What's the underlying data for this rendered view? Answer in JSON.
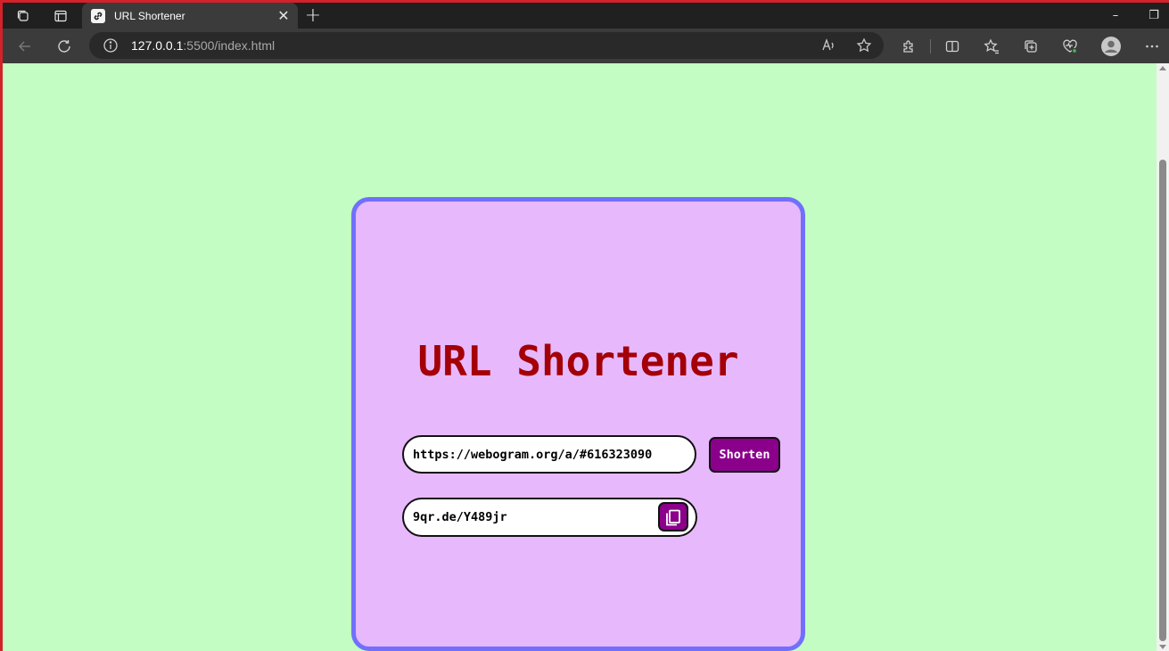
{
  "browser": {
    "tab_title": "URL Shortener",
    "address": {
      "host": "127.0.0.1",
      "rest": ":5500/index.html"
    },
    "window_controls": {
      "minimize": "–",
      "restore": "❐"
    }
  },
  "page": {
    "title": "URL Shortener",
    "url_input_value": "https://webogram.org/a/#616323090",
    "shorten_label": "Shorten",
    "short_url": "9qr.de/Y489jr"
  },
  "colors": {
    "page_background": "#c3fdc3",
    "card_background": "#e7b8fc",
    "card_border": "#7070fb",
    "title": "#a40008",
    "button": "#8b008b"
  }
}
